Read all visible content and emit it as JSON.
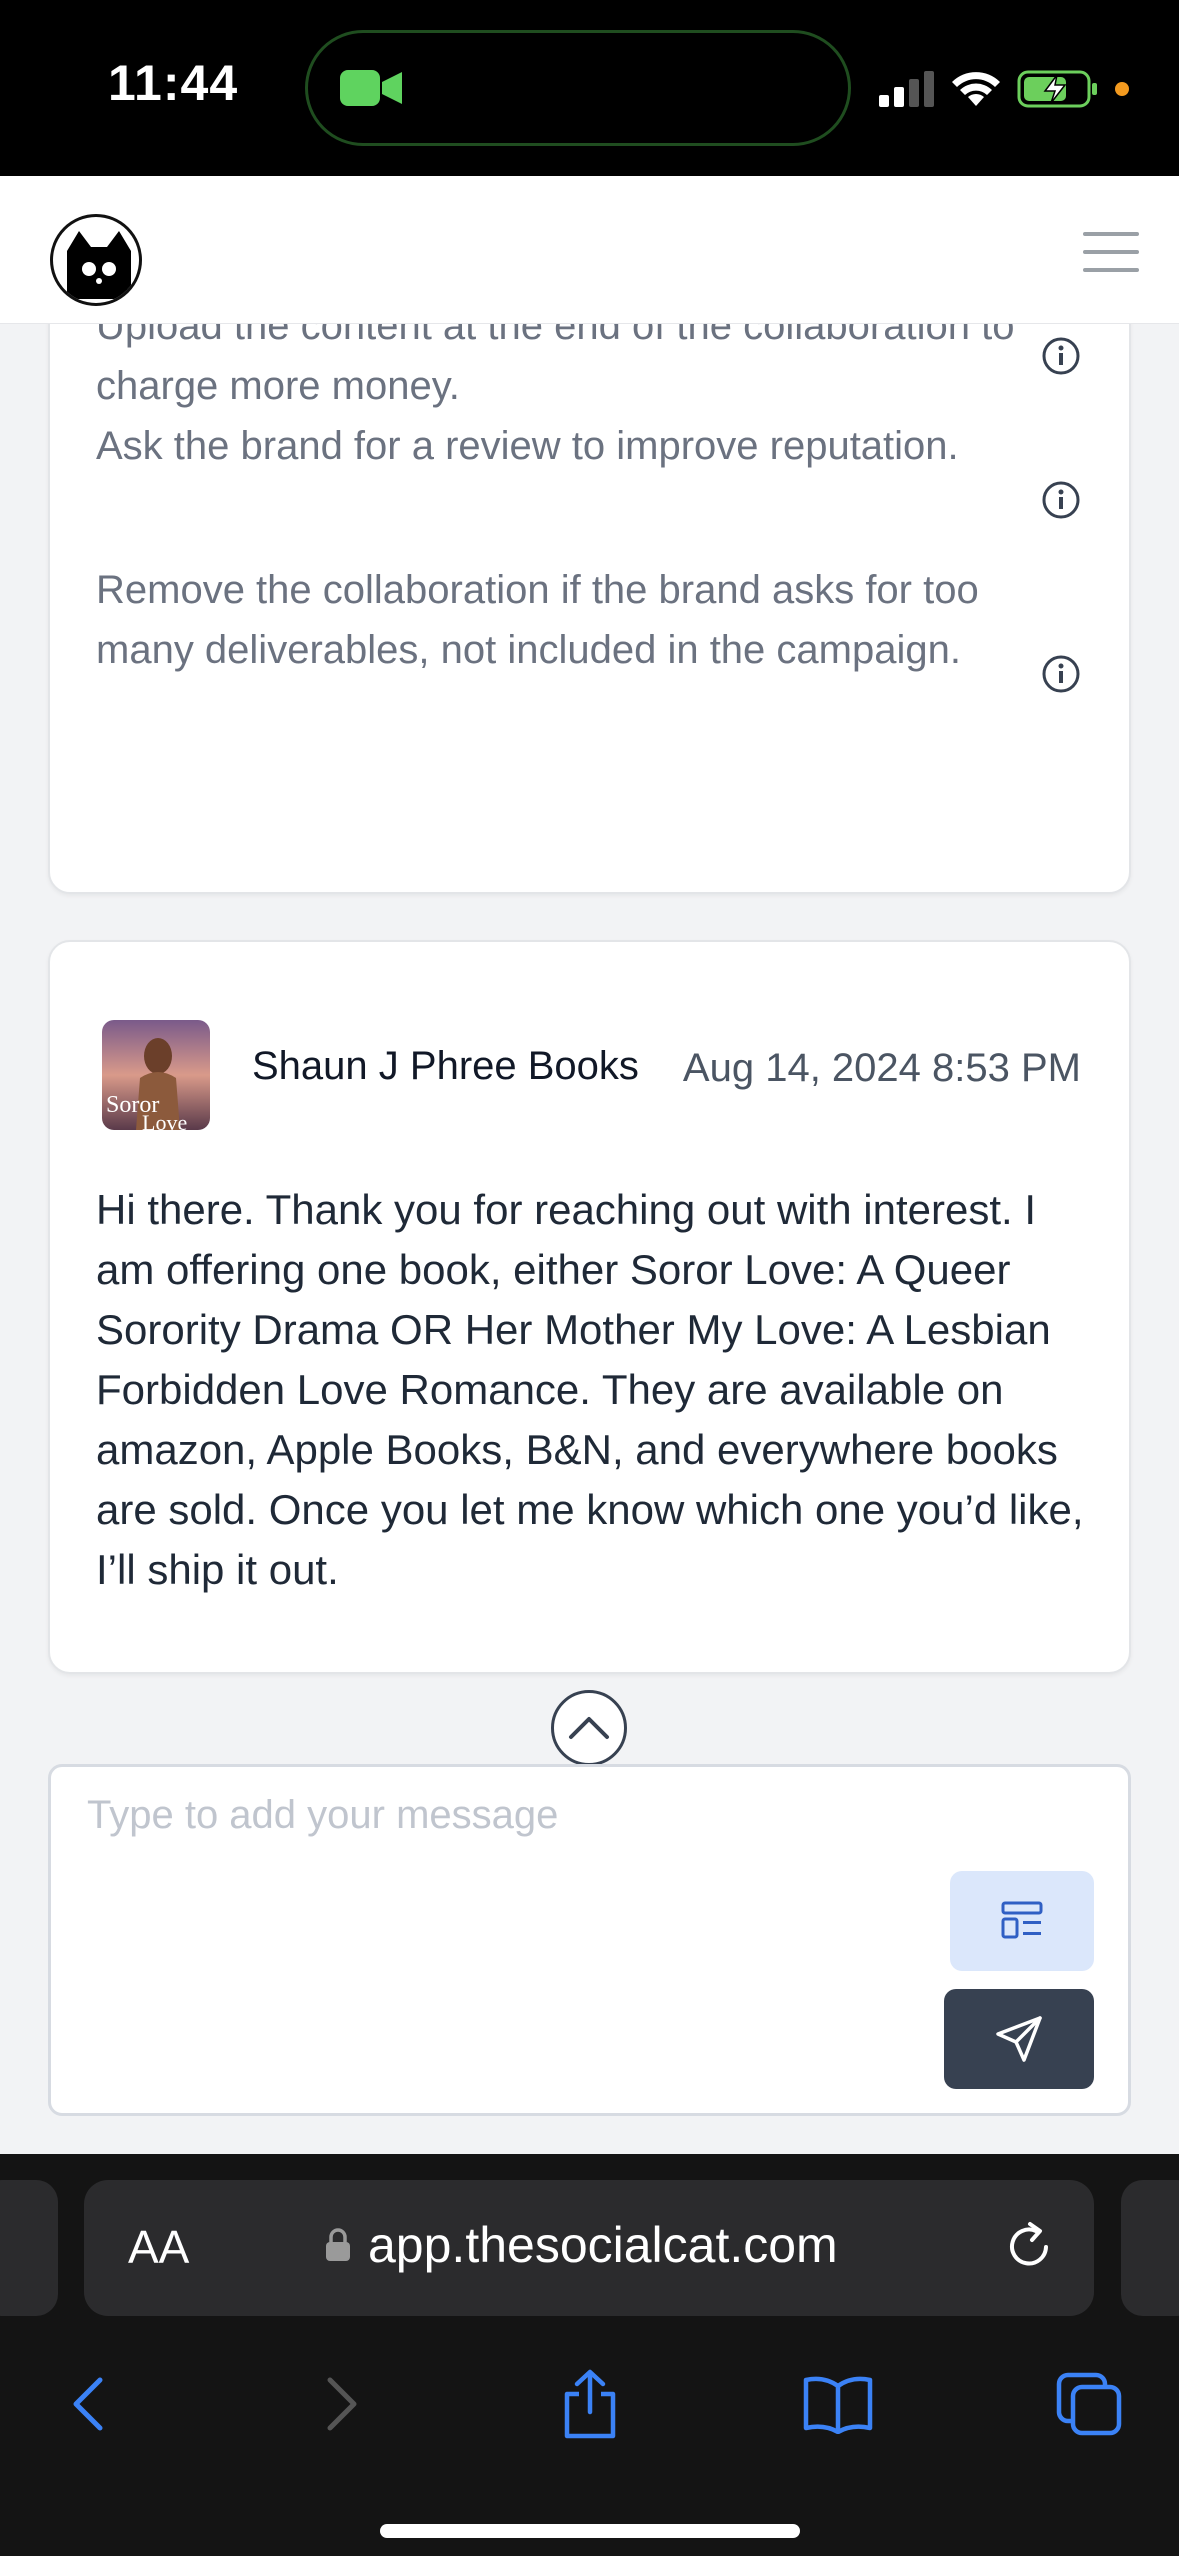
{
  "status_bar": {
    "time": "11:44"
  },
  "tips": [
    {
      "text": "Upload the content at the end of the collaboration to charge more money."
    },
    {
      "text": "Ask the brand for a review to improve reputation."
    },
    {
      "text": "Remove the collaboration if the brand asks for too many deliverables, not included in the campaign."
    }
  ],
  "message": {
    "sender": "Shaun J Phree Books",
    "date": "Aug 14, 2024 8:53 PM",
    "avatar_text": "Soror Love",
    "body": "Hi there. Thank you for reaching out with interest. I am offering one book, either Soror Love: A Queer Sorority Drama OR Her Mother My Love: A Lesbian Forbidden Love Romance. They are available on amazon, Apple Books, B&N, and everywhere books are sold. Once you let me know which one you’d like, I’ll ship it out."
  },
  "composer": {
    "placeholder": "Type to add your message"
  },
  "browser": {
    "aa_label": "AA",
    "url": "app.thesocialcat.com"
  },
  "colors": {
    "accent_blue": "#2f6fe0",
    "send_button": "#374151",
    "template_button": "#dbe7fb"
  }
}
